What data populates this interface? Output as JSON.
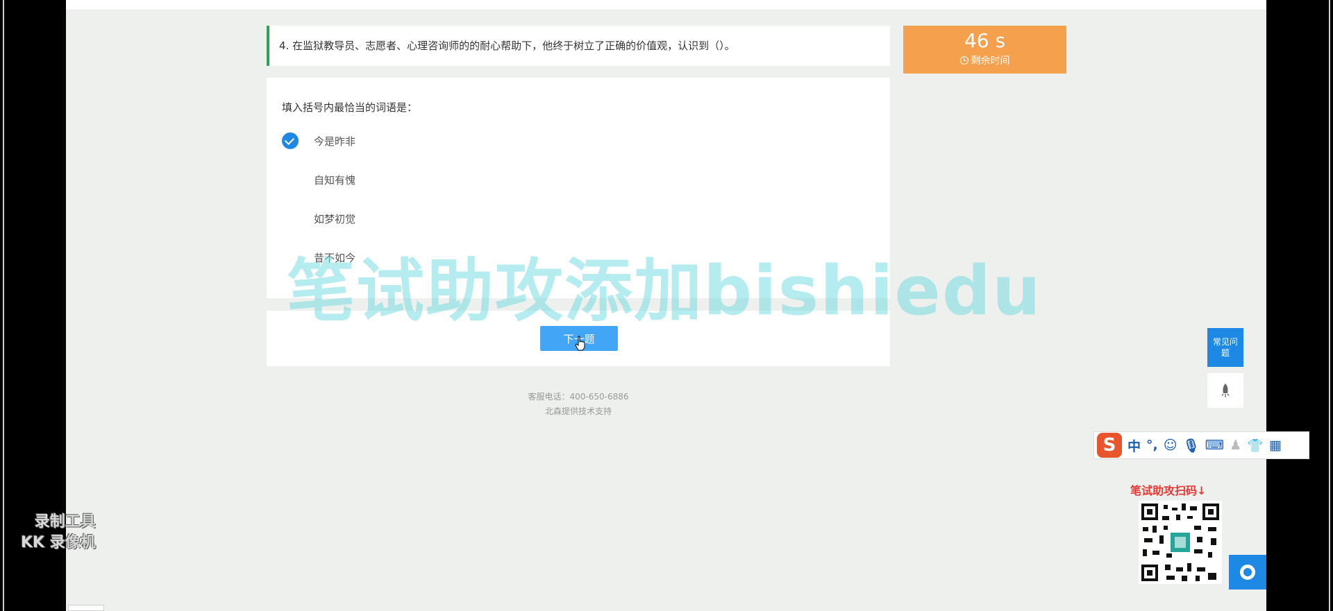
{
  "question": {
    "text": "4. 在监狱教导员、志愿者、心理咨询师的的耐心帮助下，他终于树立了正确的价值观，认识到（）。"
  },
  "timer": {
    "value": "46 s",
    "label": "剩余时间"
  },
  "card": {
    "prompt": "填入括号内最恰当的词语是：",
    "options": [
      {
        "label": "今是昨非",
        "selected": true
      },
      {
        "label": "自知有愧",
        "selected": false
      },
      {
        "label": "如梦初觉",
        "selected": false
      },
      {
        "label": "昔不如今",
        "selected": false
      }
    ]
  },
  "next_button": {
    "label": "下一题"
  },
  "footer": {
    "phone": "客服电话：400-650-6886",
    "support": "北森提供技术支持"
  },
  "watermark": {
    "text": "笔试助攻添加bishiedu"
  },
  "faq": {
    "label": "常见问题"
  },
  "ime": {
    "lang": "中",
    "punct": "°,"
  },
  "qr": {
    "title": "笔试助攻扫码↓"
  },
  "recorder": {
    "line1": "录制工具",
    "line2": "KK 录像机"
  },
  "colors": {
    "accent": "#1e88e5",
    "timer": "#f5a04d",
    "question_bar": "#2ea44f"
  }
}
